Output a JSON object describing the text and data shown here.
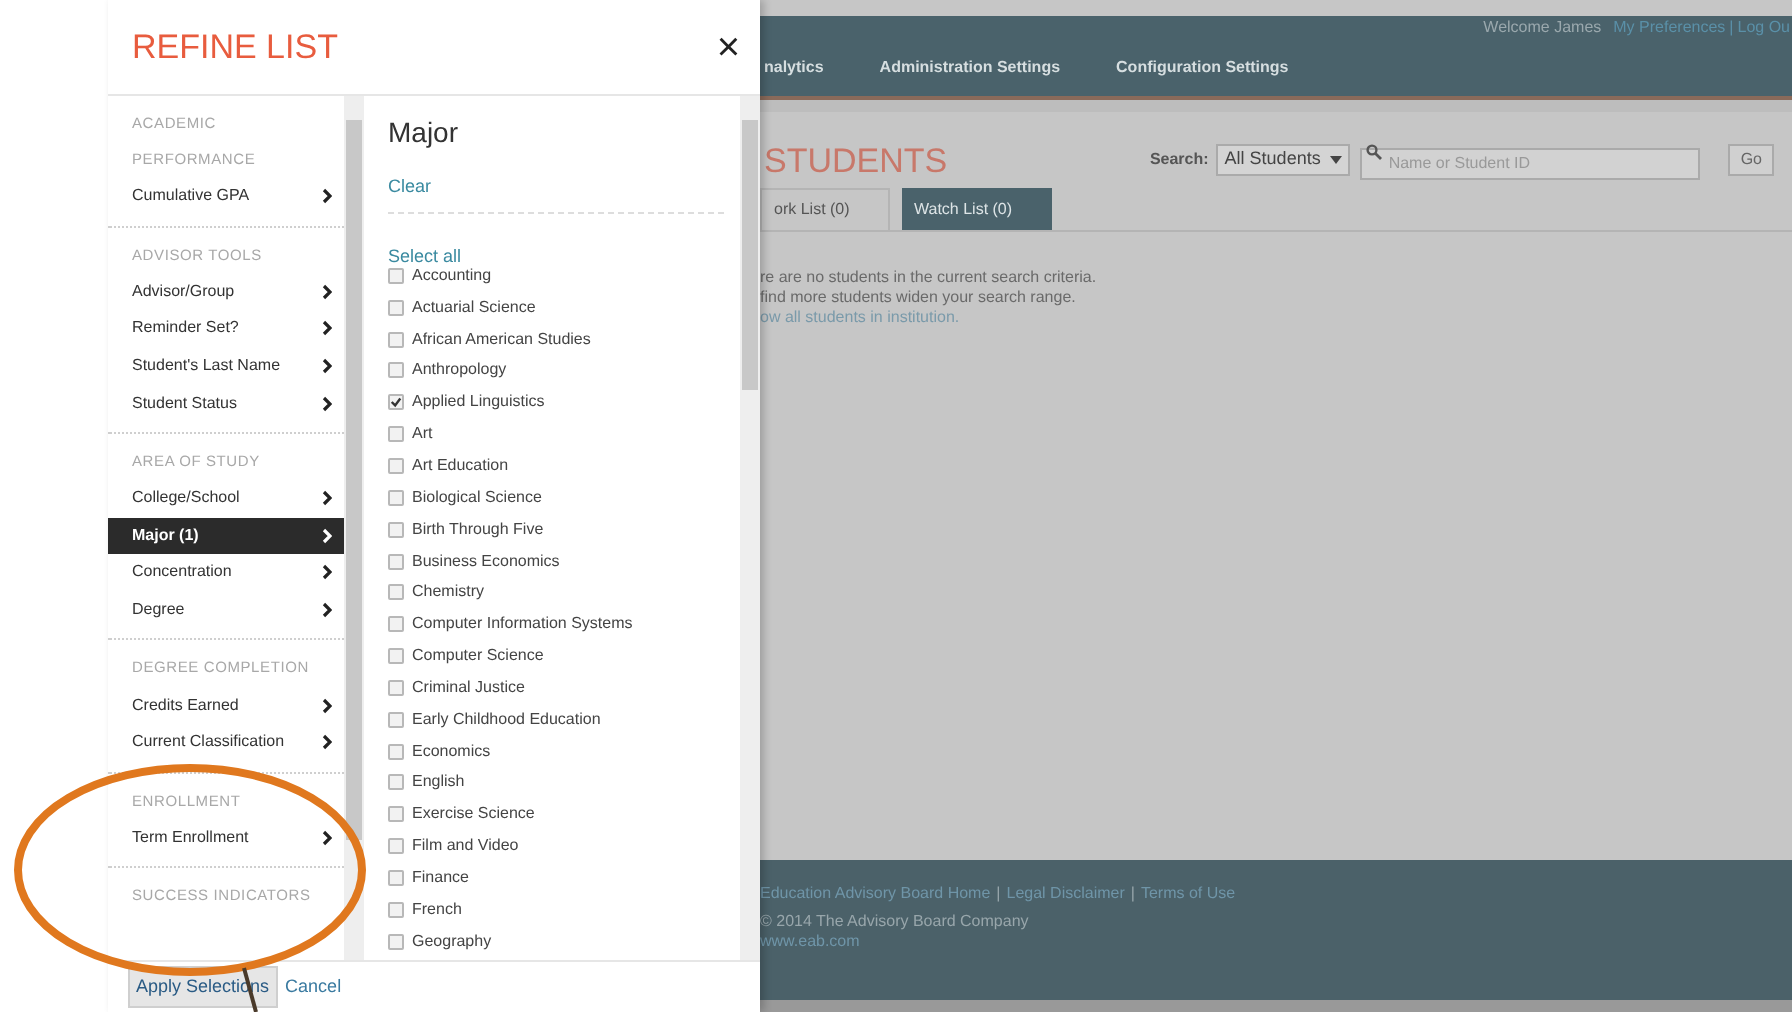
{
  "refine_panel": {
    "title": "REFINE LIST",
    "close": "×",
    "sections": [
      {
        "title": "ACADEMIC PERFORMANCE",
        "items": [
          {
            "label": "Cumulative GPA",
            "selected": false
          }
        ]
      },
      {
        "title": "ADVISOR TOOLS",
        "items": [
          {
            "label": "Advisor/Group",
            "selected": false
          },
          {
            "label": "Reminder Set?",
            "selected": false
          },
          {
            "label": "Student's Last Name",
            "selected": false
          },
          {
            "label": "Student Status",
            "selected": false
          }
        ]
      },
      {
        "title": "AREA OF STUDY",
        "items": [
          {
            "label": "College/School",
            "selected": false
          },
          {
            "label": "Major (1)",
            "selected": true
          },
          {
            "label": "Concentration",
            "selected": false
          },
          {
            "label": "Degree",
            "selected": false
          }
        ]
      },
      {
        "title": "DEGREE COMPLETION",
        "items": [
          {
            "label": "Credits Earned",
            "selected": false
          },
          {
            "label": "Current Classification",
            "selected": false
          }
        ]
      },
      {
        "title": "ENROLLMENT",
        "items": [
          {
            "label": "Term Enrollment",
            "selected": false
          }
        ]
      },
      {
        "title": "SUCCESS INDICATORS"
      }
    ],
    "detail": {
      "title": "Major",
      "clear": "Clear",
      "select_all": "Select all",
      "options": [
        {
          "label": "Accounting",
          "checked": false
        },
        {
          "label": "Actuarial Science",
          "checked": false
        },
        {
          "label": "African American Studies",
          "checked": false
        },
        {
          "label": "Anthropology",
          "checked": false
        },
        {
          "label": "Applied Linguistics",
          "checked": true
        },
        {
          "label": "Art",
          "checked": false
        },
        {
          "label": "Art Education",
          "checked": false
        },
        {
          "label": "Biological Science",
          "checked": false
        },
        {
          "label": "Birth Through Five",
          "checked": false
        },
        {
          "label": "Business Economics",
          "checked": false
        },
        {
          "label": "Chemistry",
          "checked": false
        },
        {
          "label": "Computer Information Systems",
          "checked": false
        },
        {
          "label": "Computer Science",
          "checked": false
        },
        {
          "label": "Criminal Justice",
          "checked": false
        },
        {
          "label": "Early Childhood Education",
          "checked": false
        },
        {
          "label": "Economics",
          "checked": false
        },
        {
          "label": "English",
          "checked": false
        },
        {
          "label": "Exercise Science",
          "checked": false
        },
        {
          "label": "Film and Video",
          "checked": false
        },
        {
          "label": "Finance",
          "checked": false
        },
        {
          "label": "French",
          "checked": false
        },
        {
          "label": "Geography",
          "checked": false
        }
      ]
    },
    "apply": "Apply Selections",
    "cancel": "Cancel"
  },
  "app": {
    "welcome": "Welcome James",
    "user_links": [
      "My Preferences",
      "Log Ou"
    ],
    "link_separator": "|",
    "nav": [
      "nalytics",
      "Administration Settings",
      "Configuration Settings"
    ],
    "page_title": "STUDENTS",
    "search_label": "Search:",
    "search_scope": "All Students",
    "search": {
      "placeholder": "Name or Student ID"
    },
    "go": "Go",
    "tabs": [
      {
        "label": "ork List (0)",
        "selected": false
      },
      {
        "label": "Watch List (0)",
        "selected": true
      }
    ],
    "messages": [
      "re are no students in the current search criteria.",
      "find more students widen your search range."
    ],
    "show_all_link": "ow all students in institution.",
    "footer": {
      "links": [
        "Education Advisory Board Home",
        "Legal Disclaimer",
        "Terms of Use"
      ],
      "separator": "|",
      "copyright": "© 2014 The Advisory Board Company",
      "url": "www.eab.com"
    }
  }
}
